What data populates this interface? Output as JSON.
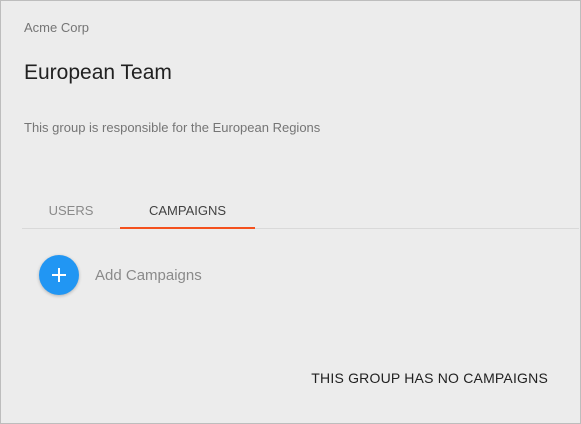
{
  "group": {
    "organization": "Acme Corp",
    "name": "European Team",
    "description": "This group is responsible for the European Regions"
  },
  "tabs": [
    {
      "label": "USERS",
      "active": false
    },
    {
      "label": "CAMPAIGNS",
      "active": true
    }
  ],
  "campaigns": {
    "add_label": "Add Campaigns",
    "add_icon": "plus-icon",
    "empty_message": "THIS GROUP HAS NO CAMPAIGNS"
  },
  "colors": {
    "accent": "#2196f3",
    "tab_indicator": "#f4511e",
    "background": "#ececec"
  }
}
